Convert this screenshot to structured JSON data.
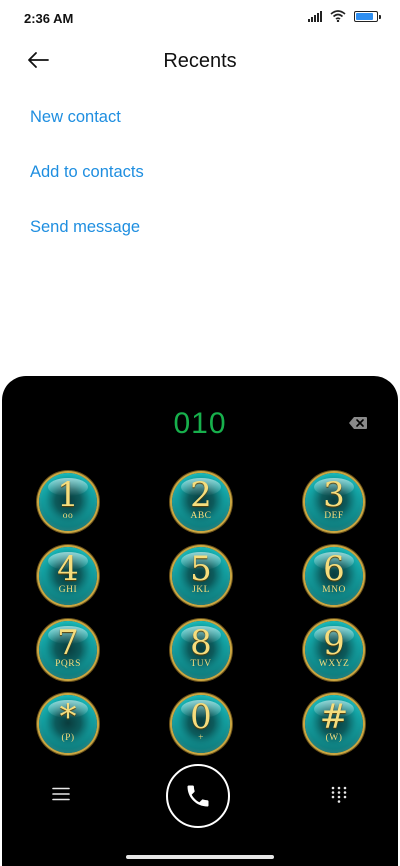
{
  "status_bar": {
    "time": "2:36 AM",
    "battery_level": 0.9,
    "accent": "#2e8ef0"
  },
  "header": {
    "title": "Recents",
    "back_icon": "arrow-left-icon"
  },
  "actions": [
    {
      "label": "New contact"
    },
    {
      "label": "Add to contacts"
    },
    {
      "label": "Send message"
    }
  ],
  "dialer": {
    "number": "010",
    "number_color": "#17b04c",
    "keys": [
      {
        "digit": "1",
        "letters": "oo"
      },
      {
        "digit": "2",
        "letters": "ABC"
      },
      {
        "digit": "3",
        "letters": "DEF"
      },
      {
        "digit": "4",
        "letters": "GHI"
      },
      {
        "digit": "5",
        "letters": "JKL"
      },
      {
        "digit": "6",
        "letters": "MNO"
      },
      {
        "digit": "7",
        "letters": "PQRS"
      },
      {
        "digit": "8",
        "letters": "TUV"
      },
      {
        "digit": "9",
        "letters": "WXYZ"
      },
      {
        "digit": "*",
        "letters": "(P)"
      },
      {
        "digit": "0",
        "letters": "+"
      },
      {
        "digit": "#",
        "letters": "(W)"
      }
    ],
    "icons": {
      "menu": "menu-icon",
      "call": "phone-icon",
      "keypad": "dialpad-icon",
      "backspace": "backspace-icon"
    }
  }
}
